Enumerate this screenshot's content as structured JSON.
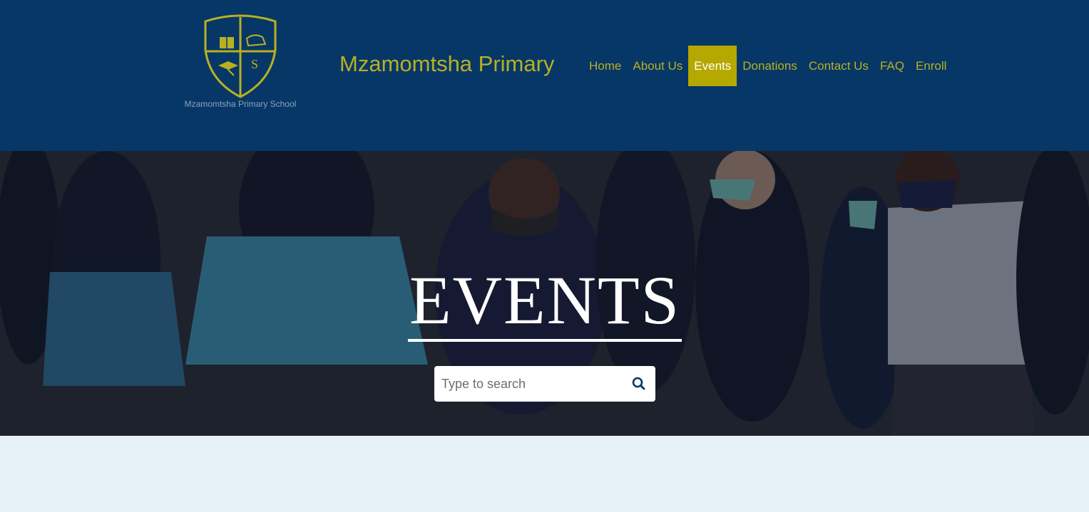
{
  "header": {
    "logo_caption": "Mzamomtsha Primary School",
    "logo_letter": "S",
    "site_title": "Mzamomtsha Primary",
    "nav": [
      {
        "label": "Home",
        "active": false
      },
      {
        "label": "About Us",
        "active": false
      },
      {
        "label": "Events",
        "active": true
      },
      {
        "label": "Donations",
        "active": false
      },
      {
        "label": "Contact Us",
        "active": false
      },
      {
        "label": "FAQ",
        "active": false
      },
      {
        "label": "Enroll",
        "active": false
      }
    ]
  },
  "hero": {
    "title": "EVENTS",
    "background": "photo of students in dark uniforms dancing, wearing face masks and tutus"
  },
  "search": {
    "placeholder": "Type to search",
    "value": "",
    "icon": "search-icon"
  },
  "colors": {
    "header_bg": "#073766",
    "brand_gold": "#b7b024",
    "active_nav_bg": "#b5a800",
    "page_bg": "#e6f2f8"
  }
}
